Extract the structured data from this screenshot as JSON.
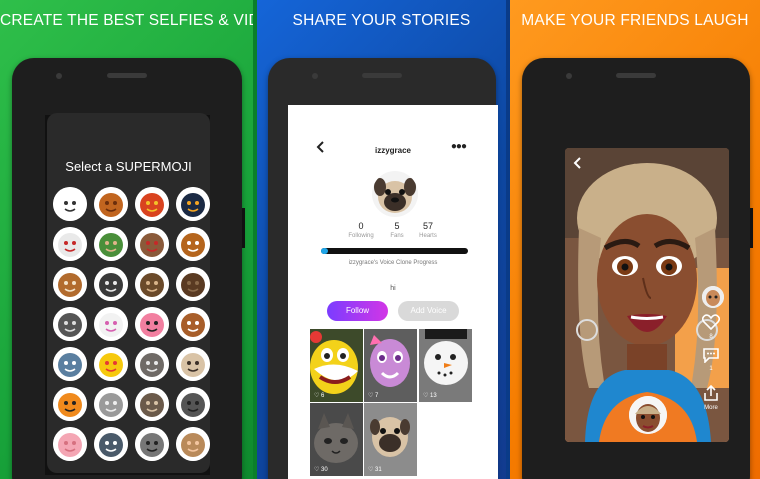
{
  "panel1": {
    "headline": "CREATE THE BEST SELFIES & VIDEOS",
    "modal_title": "Select a SUPERMOJI",
    "emojis": [
      "snowman",
      "tiki-mask",
      "dragon",
      "penguin",
      "santa",
      "elf",
      "reindeer",
      "gingerbread",
      "dog",
      "cat",
      "monkey",
      "moose",
      "wizard",
      "unicorn",
      "flamingo",
      "puppy",
      "shark",
      "heart-eyes",
      "cat-face",
      "pug",
      "tiger",
      "koala",
      "tabby-cat",
      "seal",
      "pig",
      "husky",
      "raccoon",
      "mouse"
    ],
    "colors": {
      "bg": "#18a33a",
      "modal": "#2a2a2a"
    }
  },
  "panel2": {
    "headline": "SHARE YOUR STORIES",
    "username": "izzygrace",
    "back_icon": "chevron-left-icon",
    "more_icon": "more-icon",
    "stats": [
      {
        "value": "0",
        "label": "Following"
      },
      {
        "value": "5",
        "label": "Fans"
      },
      {
        "value": "57",
        "label": "Hearts"
      }
    ],
    "progress_caption": "izzygrace's Voice Clone Progress",
    "progress_fraction": 0.05,
    "message": "hi",
    "follow_label": "Follow",
    "add_voice_label": "Add Voice",
    "videos": [
      {
        "count": "6"
      },
      {
        "count": "7"
      },
      {
        "count": "13"
      },
      {
        "count": "30"
      },
      {
        "count": "31"
      }
    ],
    "colors": {
      "bg": "#0d47a1",
      "accent": "#1fa5e8",
      "follow_from": "#7b3cff",
      "follow_to": "#d236e6"
    }
  },
  "panel3": {
    "headline": "MAKE YOUR FRIENDS LAUGH",
    "likes": "8",
    "comments": "1",
    "more_label": "More",
    "icons": [
      "back-icon",
      "heart-icon",
      "comment-icon",
      "share-icon"
    ],
    "colors": {
      "bg": "#f57c00"
    }
  }
}
